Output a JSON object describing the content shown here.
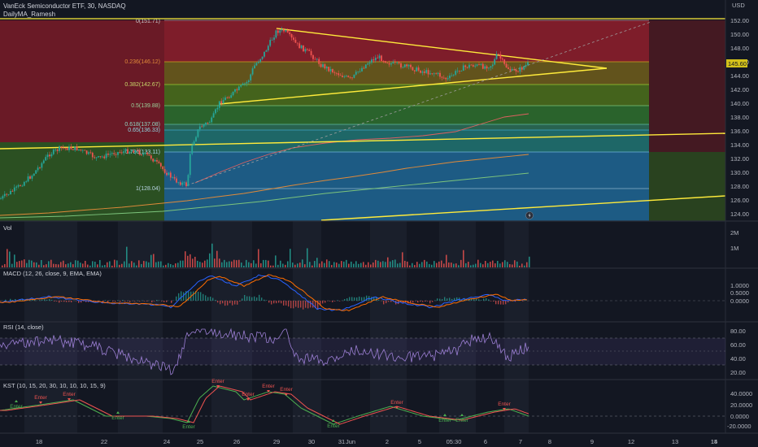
{
  "header": {
    "symbol_title": "VanEck Semiconductor ETF, 30, NASDAQ",
    "study_name": "DailyMA_Ramesh",
    "currency": "USD"
  },
  "price_axis": {
    "ticks": [
      "152.00",
      "150.00",
      "148.00",
      "146.00",
      "144.00",
      "142.00",
      "140.00",
      "138.00",
      "136.00",
      "134.00",
      "132.00",
      "130.00",
      "128.00",
      "126.00",
      "124.00"
    ],
    "current_price": "145.60"
  },
  "fib_levels": [
    {
      "label": "0(151.71)",
      "value": 151.71
    },
    {
      "label": "0.236(146.12)",
      "value": 146.12
    },
    {
      "label": "0.382(142.67)",
      "value": 142.67
    },
    {
      "label": "0.5(139.88)",
      "value": 139.88
    },
    {
      "label": "0.618(137.08)",
      "value": 137.08
    },
    {
      "label": "0.65(136.33)",
      "value": 136.33
    },
    {
      "label": "0.786(133.11)",
      "value": 133.11
    },
    {
      "label": "1(128.04)",
      "value": 128.04
    }
  ],
  "panes": {
    "volume": {
      "title": "Vol",
      "ticks": [
        "2M",
        "1M"
      ]
    },
    "macd": {
      "title": "MACD (12, 26, close, 9, EMA, EMA)",
      "ticks": [
        "1.0000",
        "0.5000",
        "0.0000"
      ]
    },
    "rsi": {
      "title": "RSI (14, close)",
      "ticks": [
        "80.00",
        "60.00",
        "40.00",
        "20.00"
      ]
    },
    "kst": {
      "title": "KST (10, 15, 20, 30, 10, 10, 10, 15, 9)",
      "ticks": [
        "40.0000",
        "20.0000",
        "0.0000",
        "-20.0000"
      ],
      "tags": [
        "Enter",
        "Enter",
        "Enter",
        "Enter",
        "Enter",
        "Enter",
        "Enter",
        "Enter",
        "Enter",
        "Enter",
        "Enter",
        "Enter",
        "Enter",
        "Enter"
      ]
    }
  },
  "time_axis": {
    "labels": [
      "18",
      "22",
      "24",
      "25",
      "26",
      "29",
      "30",
      "31",
      "Jun",
      "2",
      "5",
      "05:30",
      "6",
      "7",
      "8",
      "9",
      "12",
      "13",
      "14",
      "15"
    ]
  },
  "colors": {
    "background": "#131722",
    "trendline": "#ffeb3b",
    "candle_up": "#26a69a",
    "candle_down": "#ef5350",
    "fib_red": "#8b1e2b",
    "fib_olive": "#6b6a1c",
    "fib_green": "#2d6b2d",
    "fib_teal": "#1f6b6b",
    "fib_blue": "#1d5f8a",
    "rsi_line": "#7e57c2",
    "kst_green": "#4caf50",
    "kst_red": "#ef5350"
  }
}
